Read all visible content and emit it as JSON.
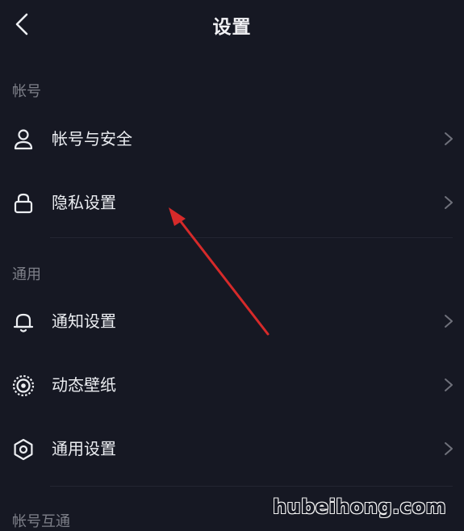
{
  "header": {
    "title": "设置",
    "back_icon": "chevron-left-icon"
  },
  "sections": [
    {
      "title": "帐号",
      "items": [
        {
          "label": "帐号与安全",
          "icon": "user-icon"
        },
        {
          "label": "隐私设置",
          "icon": "lock-icon"
        }
      ]
    },
    {
      "title": "通用",
      "items": [
        {
          "label": "通知设置",
          "icon": "bell-icon"
        },
        {
          "label": "动态壁纸",
          "icon": "live-wallpaper-icon"
        },
        {
          "label": "通用设置",
          "icon": "gear-icon"
        }
      ]
    },
    {
      "title": "帐号互通",
      "items": []
    }
  ],
  "watermark": "hubeihong.com",
  "colors": {
    "background": "#161823",
    "text": "#eceef2",
    "section_text": "#7d7f88",
    "chevron": "#6f717b",
    "annotation_arrow": "#d62a2a"
  }
}
